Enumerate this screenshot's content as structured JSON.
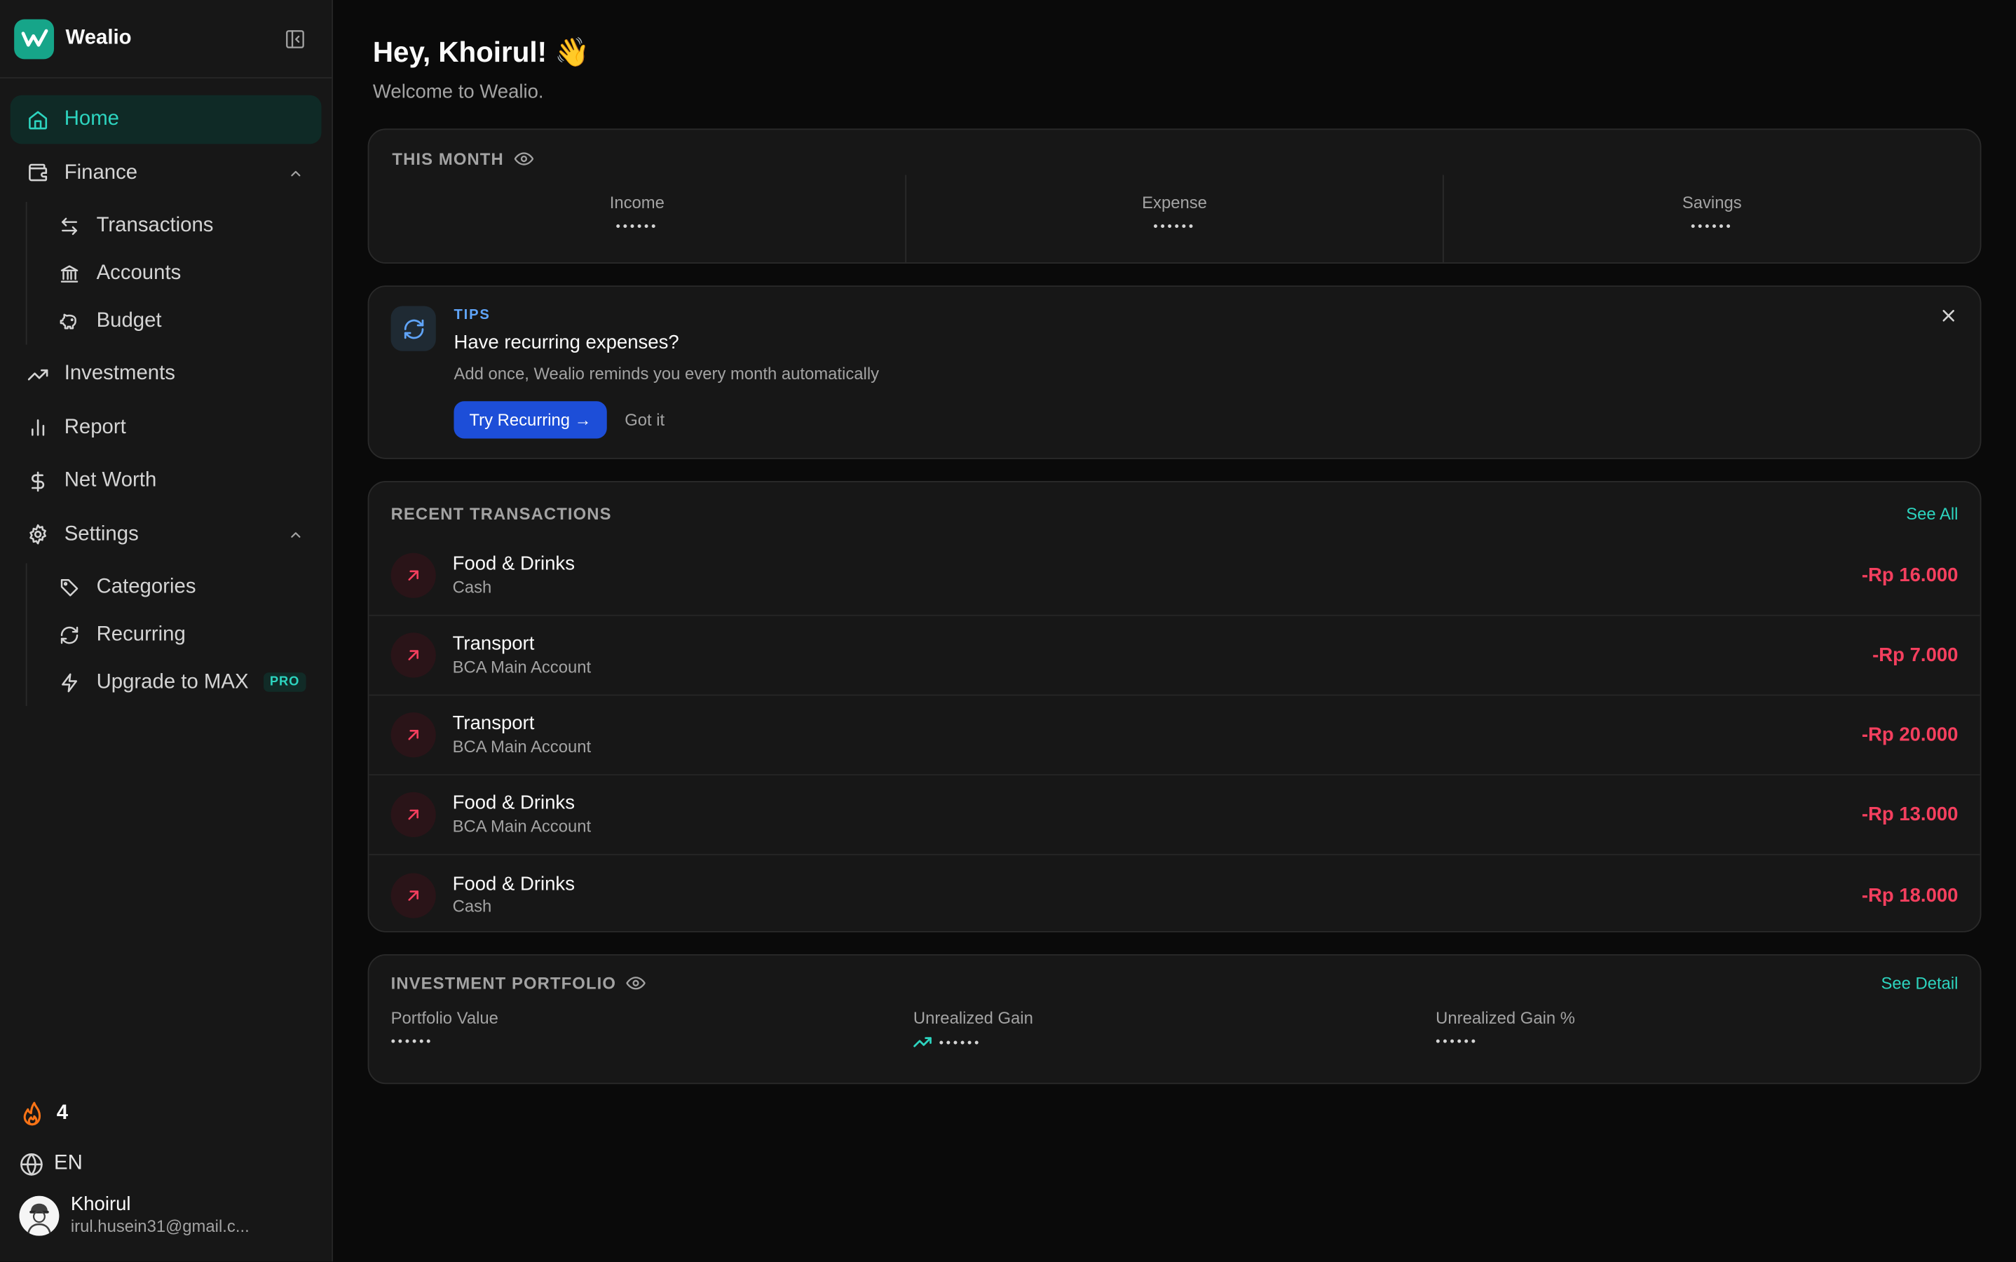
{
  "app": {
    "name": "Wealio"
  },
  "sidebar": {
    "items": [
      {
        "label": "Home"
      },
      {
        "label": "Finance"
      },
      {
        "label": "Transactions"
      },
      {
        "label": "Accounts"
      },
      {
        "label": "Budget"
      },
      {
        "label": "Investments"
      },
      {
        "label": "Report"
      },
      {
        "label": "Net Worth"
      },
      {
        "label": "Settings"
      },
      {
        "label": "Categories"
      },
      {
        "label": "Recurring"
      },
      {
        "label": "Upgrade to MAX",
        "badge": "PRO"
      }
    ],
    "streak": "4",
    "language": "EN",
    "user": {
      "name": "Khoirul",
      "email": "irul.husein31@gmail.c..."
    }
  },
  "greeting": {
    "title": "Hey, Khoirul! 👋",
    "subtitle": "Welcome to Wealio."
  },
  "this_month": {
    "title": "THIS MONTH",
    "columns": [
      {
        "label": "Income",
        "value": "••••••"
      },
      {
        "label": "Expense",
        "value": "••••••"
      },
      {
        "label": "Savings",
        "value": "••••••"
      }
    ]
  },
  "tips": {
    "tag": "TIPS",
    "title": "Have recurring expenses?",
    "description": "Add once, Wealio reminds you every month automatically",
    "primary": "Try Recurring →",
    "secondary": "Got it"
  },
  "recent_transactions": {
    "title": "RECENT TRANSACTIONS",
    "see_all": "See All",
    "rows": [
      {
        "category": "Food & Drinks",
        "account": "Cash",
        "amount": "-Rp 16.000"
      },
      {
        "category": "Transport",
        "account": "BCA Main Account",
        "amount": "-Rp 7.000"
      },
      {
        "category": "Transport",
        "account": "BCA Main Account",
        "amount": "-Rp 20.000"
      },
      {
        "category": "Food & Drinks",
        "account": "BCA Main Account",
        "amount": "-Rp 13.000"
      },
      {
        "category": "Food & Drinks",
        "account": "Cash",
        "amount": "-Rp 18.000"
      }
    ]
  },
  "investment": {
    "title": "INVESTMENT PORTFOLIO",
    "see_detail": "See Detail",
    "columns": [
      {
        "label": "Portfolio Value",
        "value": "••••••"
      },
      {
        "label": "Unrealized Gain",
        "value": "••••••"
      },
      {
        "label": "Unrealized Gain %",
        "value": "••••••"
      }
    ]
  },
  "colors": {
    "accent": "#2dd4bf",
    "expense": "#f43f5e",
    "primary_button": "#1d4ed8",
    "tips": "#60a5fa"
  },
  "icons": {
    "home": "home-icon",
    "finance": "wallet-icon",
    "transactions": "arrows-swap-icon",
    "accounts": "bank-icon",
    "budget": "piggy-bank-icon",
    "investments": "trending-up-icon",
    "report": "bar-chart-icon",
    "net_worth": "dollar-icon",
    "settings": "gear-icon",
    "categories": "tag-icon",
    "recurring": "refresh-icon",
    "upgrade": "bolt-icon",
    "streak": "flame-icon",
    "language": "globe-icon"
  }
}
